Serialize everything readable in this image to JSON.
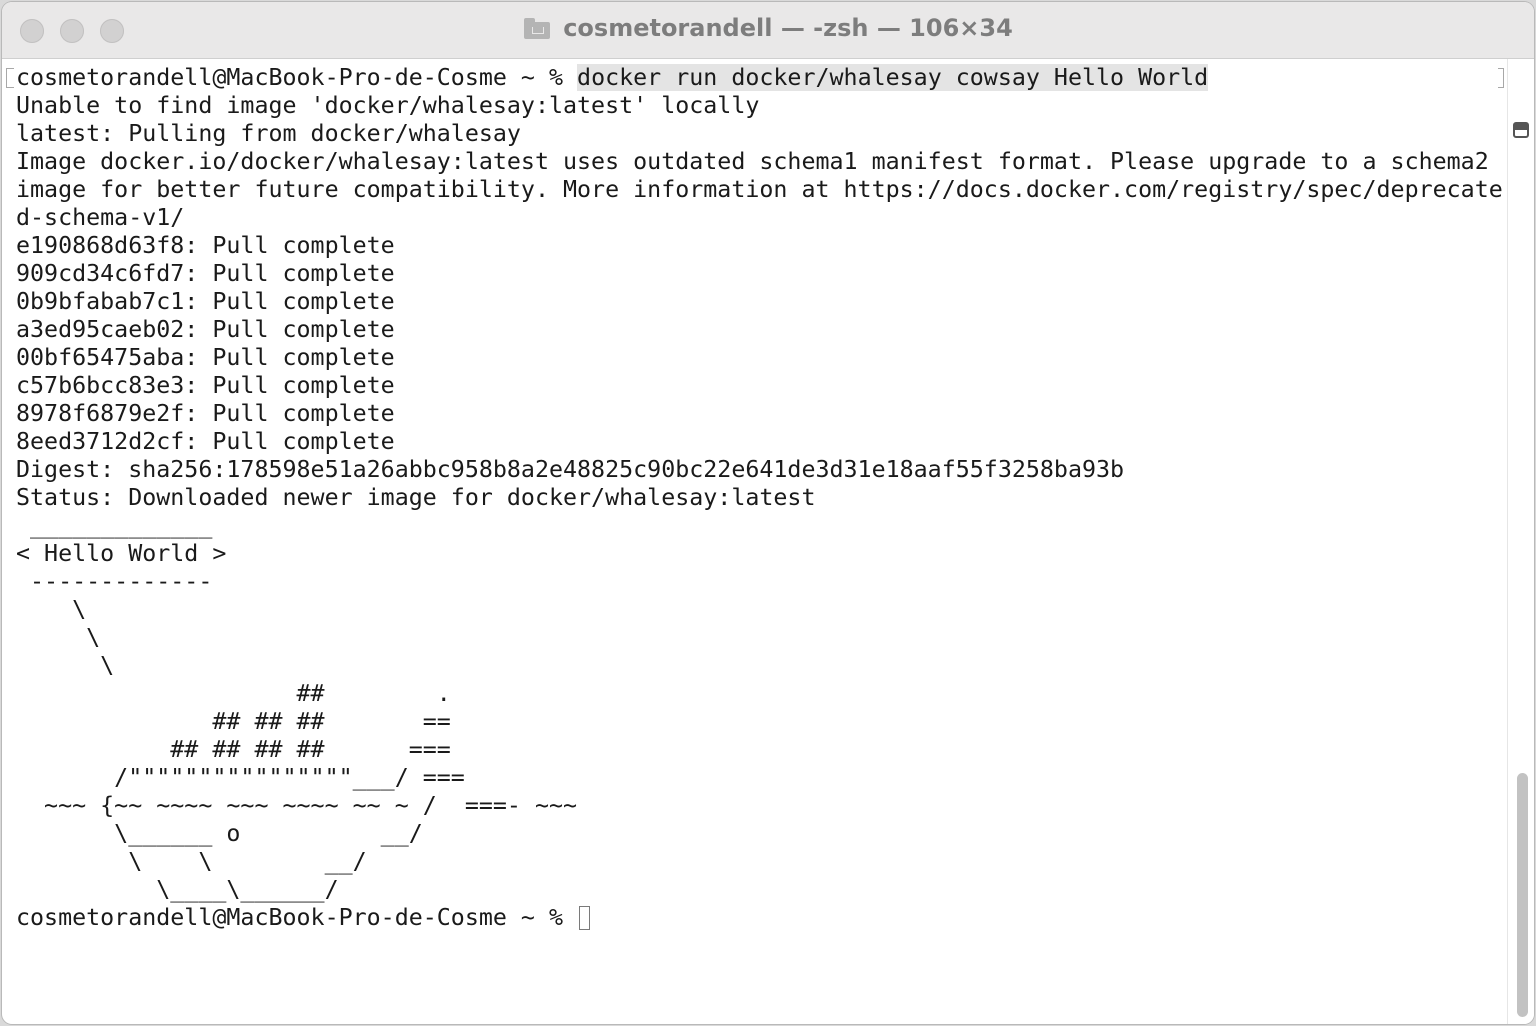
{
  "window": {
    "title": "cosmetorandell — -zsh — 106×34"
  },
  "terminal": {
    "prompt": "cosmetorandell@MacBook-Pro-de-Cosme ~ % ",
    "command": "docker run docker/whalesay cowsay Hello World",
    "output_lines": [
      "Unable to find image 'docker/whalesay:latest' locally",
      "latest: Pulling from docker/whalesay",
      "Image docker.io/docker/whalesay:latest uses outdated schema1 manifest format. Please upgrade to a schema2",
      "image for better future compatibility. More information at https://docs.docker.com/registry/spec/deprecate",
      "d-schema-v1/",
      "e190868d63f8: Pull complete",
      "909cd34c6fd7: Pull complete",
      "0b9bfabab7c1: Pull complete",
      "a3ed95caeb02: Pull complete",
      "00bf65475aba: Pull complete",
      "c57b6bcc83e3: Pull complete",
      "8978f6879e2f: Pull complete",
      "8eed3712d2cf: Pull complete",
      "Digest: sha256:178598e51a26abbc958b8a2e48825c90bc22e641de3d31e18aaf55f3258ba93b",
      "Status: Downloaded newer image for docker/whalesay:latest",
      " _____________",
      "< Hello World >",
      " -------------",
      "    \\",
      "     \\",
      "      \\",
      "                    ##        .",
      "              ## ## ##       ==",
      "           ## ## ## ##      ===",
      "       /\"\"\"\"\"\"\"\"\"\"\"\"\"\"\"\"___/ ===",
      "  ~~~ {~~ ~~~~ ~~~ ~~~~ ~~ ~ /  ===- ~~~",
      "       \\______ o          __/",
      "        \\    \\        __/",
      "          \\____\\______/"
    ],
    "final_prompt": "cosmetorandell@MacBook-Pro-de-Cosme ~ % "
  },
  "colors": {
    "titlebar": "#e9e8e8",
    "title_text": "#7d7d7d",
    "text": "#1a1a1a",
    "command_highlight": "#e4e4e4",
    "scroll_thumb": "#c2c2c2"
  },
  "icons": {
    "title": "folder-icon",
    "split": "split-pane-icon"
  }
}
